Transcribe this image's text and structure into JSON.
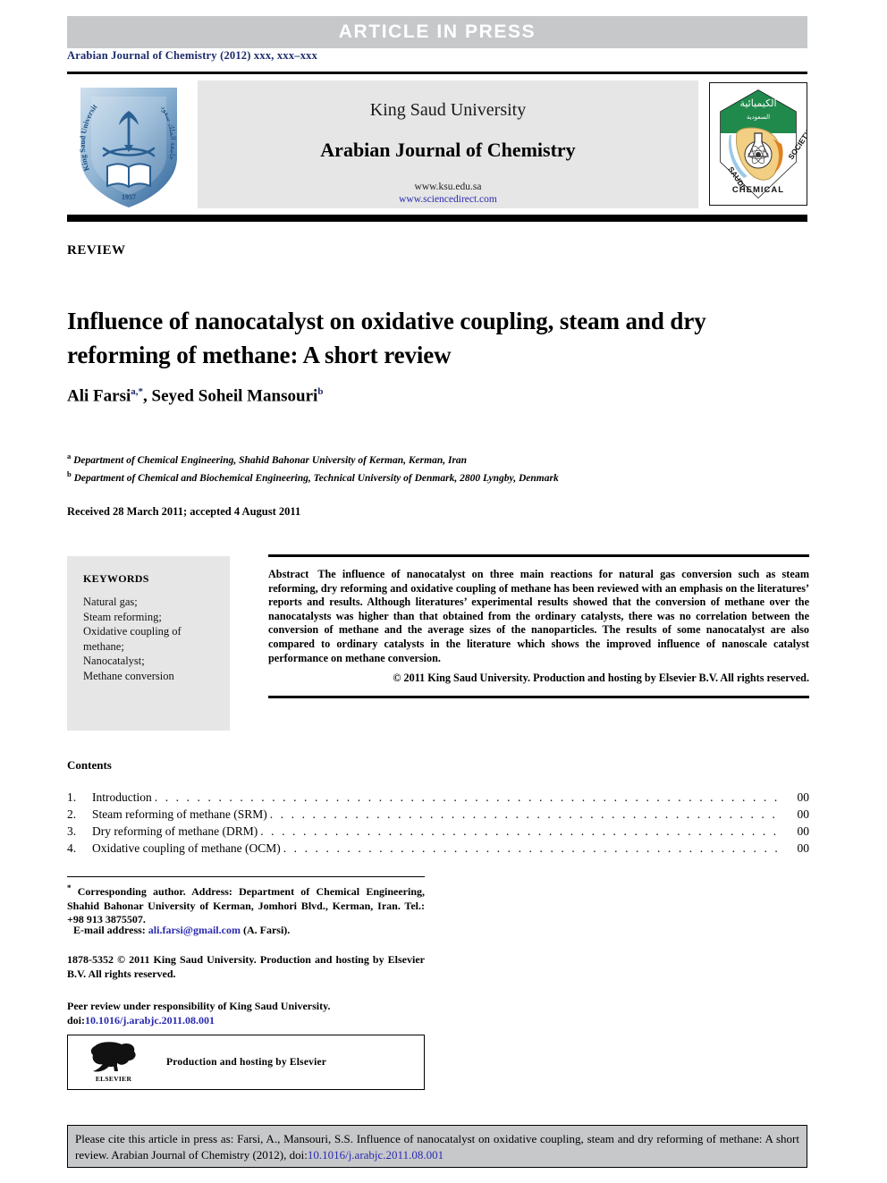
{
  "banner": {
    "label": "ARTICLE  IN  PRESS"
  },
  "journal_line": "Arabian Journal of Chemistry (2012) xxx, xxx–xxx",
  "masthead": {
    "university": "King Saud University",
    "journal_title": "Arabian Journal of Chemistry",
    "url_ksu": "www.ksu.edu.sa",
    "url_sciencedirect": "www.sciencedirect.com",
    "left_logo_name": "king-saud-university-logo",
    "right_logo_name": "saudi-chemical-society-logo",
    "scs_logo_text": {
      "arabic_top": "الكيميائية",
      "saudi": "SAUDI",
      "society": "SOCIETY",
      "chemical": "CHEMICAL"
    }
  },
  "article": {
    "type_label": "REVIEW",
    "title": "Influence of nanocatalyst on oxidative coupling, steam and dry reforming of methane: A short review",
    "authors": [
      {
        "name": "Ali Farsi",
        "marks": "a,*"
      },
      {
        "name": "Seyed Soheil Mansouri",
        "marks": "b"
      }
    ],
    "affiliations": [
      {
        "mark": "a",
        "text": "Department of Chemical Engineering, Shahid Bahonar University of Kerman, Kerman, Iran"
      },
      {
        "mark": "b",
        "text": "Department of Chemical and Biochemical Engineering, Technical University of Denmark, 2800 Lyngby, Denmark"
      }
    ],
    "dates": "Received 28 March 2011; accepted 4 August 2011"
  },
  "keywords": {
    "heading": "KEYWORDS",
    "items": [
      "Natural gas;",
      "Steam reforming;",
      "Oxidative coupling of",
      "methane;",
      "Nanocatalyst;",
      "Methane conversion"
    ]
  },
  "abstract": {
    "label": "Abstract",
    "text": "The influence of nanocatalyst on three main reactions for natural gas conversion such as steam reforming, dry reforming and oxidative coupling of methane has been reviewed with an emphasis on the literatures’ reports and results. Although literatures’ experimental results showed that the conversion of methane over the nanocatalysts was higher than that obtained from the ordinary catalysts, there was no correlation between the conversion of methane and the average sizes of the nanoparticles. The results of some nanocatalyst are also compared to ordinary catalysts in the literature which shows the improved influence of nanoscale catalyst performance on methane conversion.",
    "copyright": "© 2011 King Saud University. Production and hosting by Elsevier B.V. All rights reserved."
  },
  "contents": {
    "heading": "Contents",
    "rows": [
      {
        "num": "1.",
        "label": "Introduction",
        "page": "00"
      },
      {
        "num": "2.",
        "label": "Steam reforming of methane (SRM)",
        "page": "00"
      },
      {
        "num": "3.",
        "label": "Dry reforming of methane (DRM)",
        "page": "00"
      },
      {
        "num": "4.",
        "label": "Oxidative coupling of methane (OCM)",
        "page": "00"
      }
    ],
    "leader": ". . . . . . . . . . . . . . . . . . . . . . . . . . . . . . . . . . . . . . . . . . . . . . . . . . . . . . . . . . . . . . . . . . . . . . . . . . . . . . . . . . . . . . . . . . . . . . . . . . . . . . . . . . . . . . . . . . . . . . ."
  },
  "footnotes": {
    "corresponding": "Corresponding author. Address: Department of Chemical Engineering, Shahid Bahonar University of Kerman, Jomhori Blvd., Kerman, Iran. Tel.: +98 913 3875507.",
    "corresponding_mark": "*",
    "email_label": "E-mail address:",
    "email": "ali.farsi@gmail.com",
    "email_suffix": "(A. Farsi).",
    "issn_line": "1878-5352 © 2011 King Saud University. Production and hosting by Elsevier B.V. All rights reserved.",
    "peer_review": "Peer review under responsibility of King Saud University.",
    "doi_label": "doi:",
    "doi": "10.1016/j.arabjc.2011.08.001",
    "elsevier_box": {
      "wordmark": "ELSEVIER",
      "text": "Production and hosting by Elsevier"
    }
  },
  "cite_box": {
    "text_before": "Please cite this article in press as: Farsi, A., Mansouri, S.S. Influence of nanocatalyst on oxidative coupling, steam and dry reforming of methane: A short review. Arabian Journal of Chemistry (2012), doi:",
    "doi": "10.1016/j.arabjc.2011.08.001"
  },
  "colors": {
    "banner_gray": "#c6c8ca",
    "box_gray": "#e6e6e6",
    "link_blue": "#2a2ab0",
    "journal_navy": "#1b2a6b",
    "rule_black": "#000000"
  }
}
